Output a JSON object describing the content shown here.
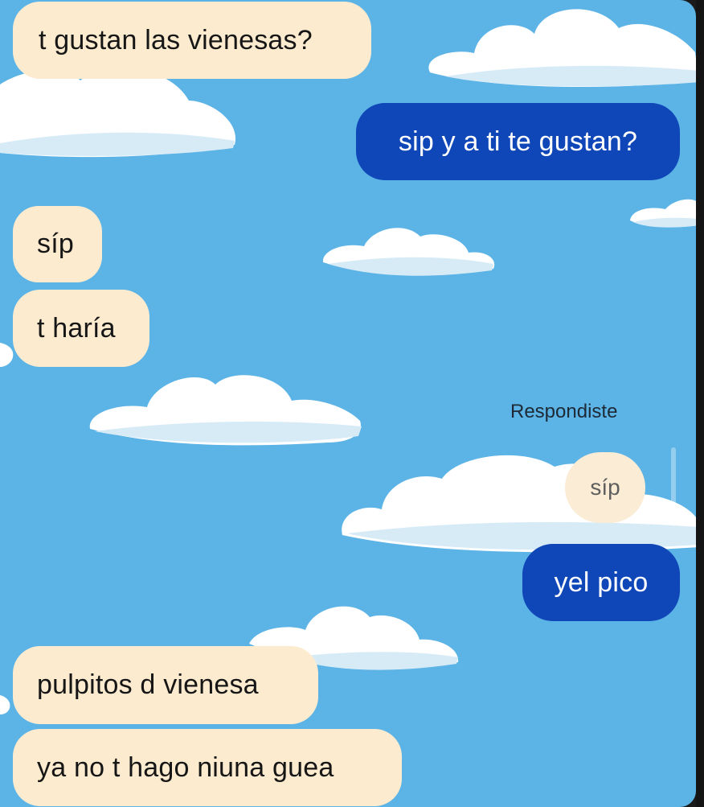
{
  "chat": {
    "background_color": "#5cb3e6",
    "incoming_color": "#fcebcf",
    "outgoing_color": "#0f47b8",
    "messages": [
      {
        "direction": "incoming",
        "text": "t gustan las vienesas?"
      },
      {
        "direction": "outgoing",
        "text": "sip y a ti te gustan?"
      },
      {
        "direction": "incoming",
        "text": "síp"
      },
      {
        "direction": "incoming",
        "text": "t haría"
      },
      {
        "direction": "outgoing",
        "reply_label": "Respondiste",
        "quoted_text": "síp",
        "text": "yel pico"
      },
      {
        "direction": "incoming",
        "text": "pulpitos d vienesa"
      },
      {
        "direction": "incoming",
        "text": "ya no t hago niuna guea"
      }
    ]
  }
}
